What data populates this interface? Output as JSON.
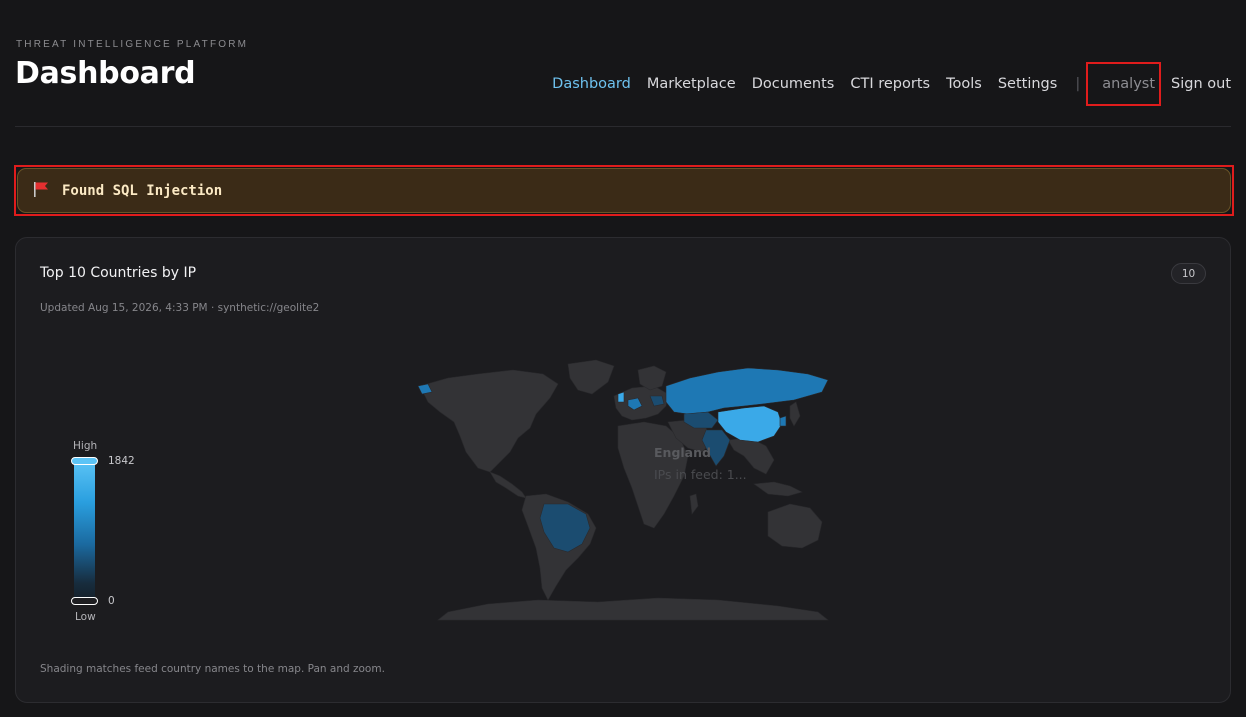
{
  "header": {
    "eyebrow": "THREAT INTELLIGENCE PLATFORM",
    "title": "Dashboard"
  },
  "nav": {
    "items": [
      {
        "label": "Dashboard",
        "active": true
      },
      {
        "label": "Marketplace"
      },
      {
        "label": "Documents"
      },
      {
        "label": "CTI reports"
      },
      {
        "label": "Tools"
      },
      {
        "label": "Settings"
      }
    ],
    "separator": "|",
    "user": "analyst",
    "signout": "Sign out"
  },
  "alert": {
    "icon": "flag-icon",
    "text": "Found SQL Injection",
    "colors": {
      "background": "#3b2b17",
      "border": "#6a5426",
      "text": "#fbe9c4"
    }
  },
  "card": {
    "title": "Top 10 Countries by IP",
    "count": "10",
    "meta": "Updated Aug 15, 2026, 4:33 PM · synthetic://geolite2",
    "footer": "Shading matches feed country names to the map. Pan and zoom.",
    "legend": {
      "high_label": "High",
      "low_label": "Low",
      "max_value": "1842",
      "min_value": "0",
      "colors": {
        "high": "#5cc4f6",
        "mid": "#1b6aa0",
        "low": "#15202a"
      }
    },
    "tooltip": {
      "country": "England",
      "text": "IPs in feed: 1..."
    },
    "map_colors": {
      "land": "#333336",
      "border": "#2a2a2d",
      "shaded_light": "#3aa9e8",
      "shaded_mid": "#1e78b4",
      "shaded_dark": "#1b4c70"
    }
  }
}
